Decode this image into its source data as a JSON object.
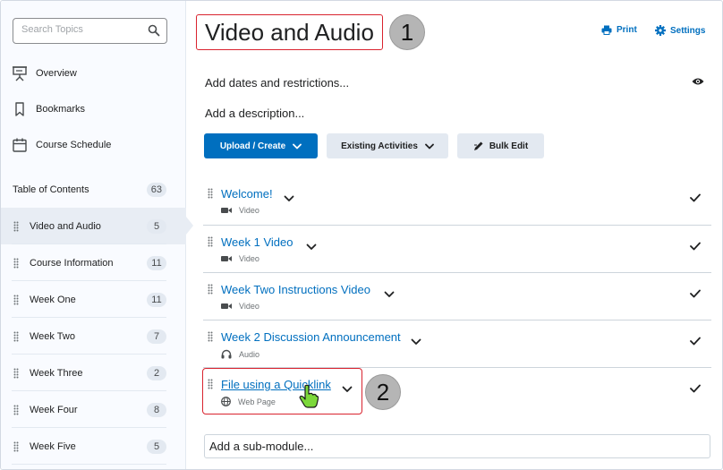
{
  "sidebar": {
    "search_placeholder": "Search Topics",
    "nav": [
      {
        "label": "Overview",
        "icon": "presentation-icon"
      },
      {
        "label": "Bookmarks",
        "icon": "bookmark-icon"
      },
      {
        "label": "Course Schedule",
        "icon": "calendar-icon"
      }
    ],
    "toc": {
      "label": "Table of Contents",
      "count": "63"
    },
    "modules": [
      {
        "label": "Video and Audio",
        "count": "5",
        "active": true
      },
      {
        "label": "Course Information",
        "count": "11"
      },
      {
        "label": "Week One",
        "count": "11"
      },
      {
        "label": "Week Two",
        "count": "7"
      },
      {
        "label": "Week Three",
        "count": "2"
      },
      {
        "label": "Week Four",
        "count": "8"
      },
      {
        "label": "Week Five",
        "count": "5"
      }
    ]
  },
  "main": {
    "title": "Video and Audio",
    "callout_1": "1",
    "callout_2": "2",
    "print_label": "Print",
    "settings_label": "Settings",
    "add_dates_label": "Add dates and restrictions...",
    "add_description_label": "Add a description...",
    "upload_create_label": "Upload / Create",
    "existing_activities_label": "Existing Activities",
    "bulk_edit_label": "Bulk Edit",
    "topics": [
      {
        "title": "Welcome!",
        "type": "Video",
        "icon": "video-camera-icon"
      },
      {
        "title": "Week 1 Video",
        "type": "Video",
        "icon": "video-camera-icon"
      },
      {
        "title": "Week Two Instructions Video",
        "type": "Video",
        "icon": "video-camera-icon"
      },
      {
        "title": "Week 2 Discussion Announcement",
        "type": "Audio",
        "icon": "headphones-icon"
      },
      {
        "title": "File using a Quicklink",
        "type": "Web Page",
        "icon": "globe-icon"
      }
    ],
    "add_submodule_label": "Add a sub-module...",
    "colors": {
      "link": "#006fbf",
      "callout_border": "#d9232e",
      "callout_bg": "#b5b5b5"
    }
  }
}
